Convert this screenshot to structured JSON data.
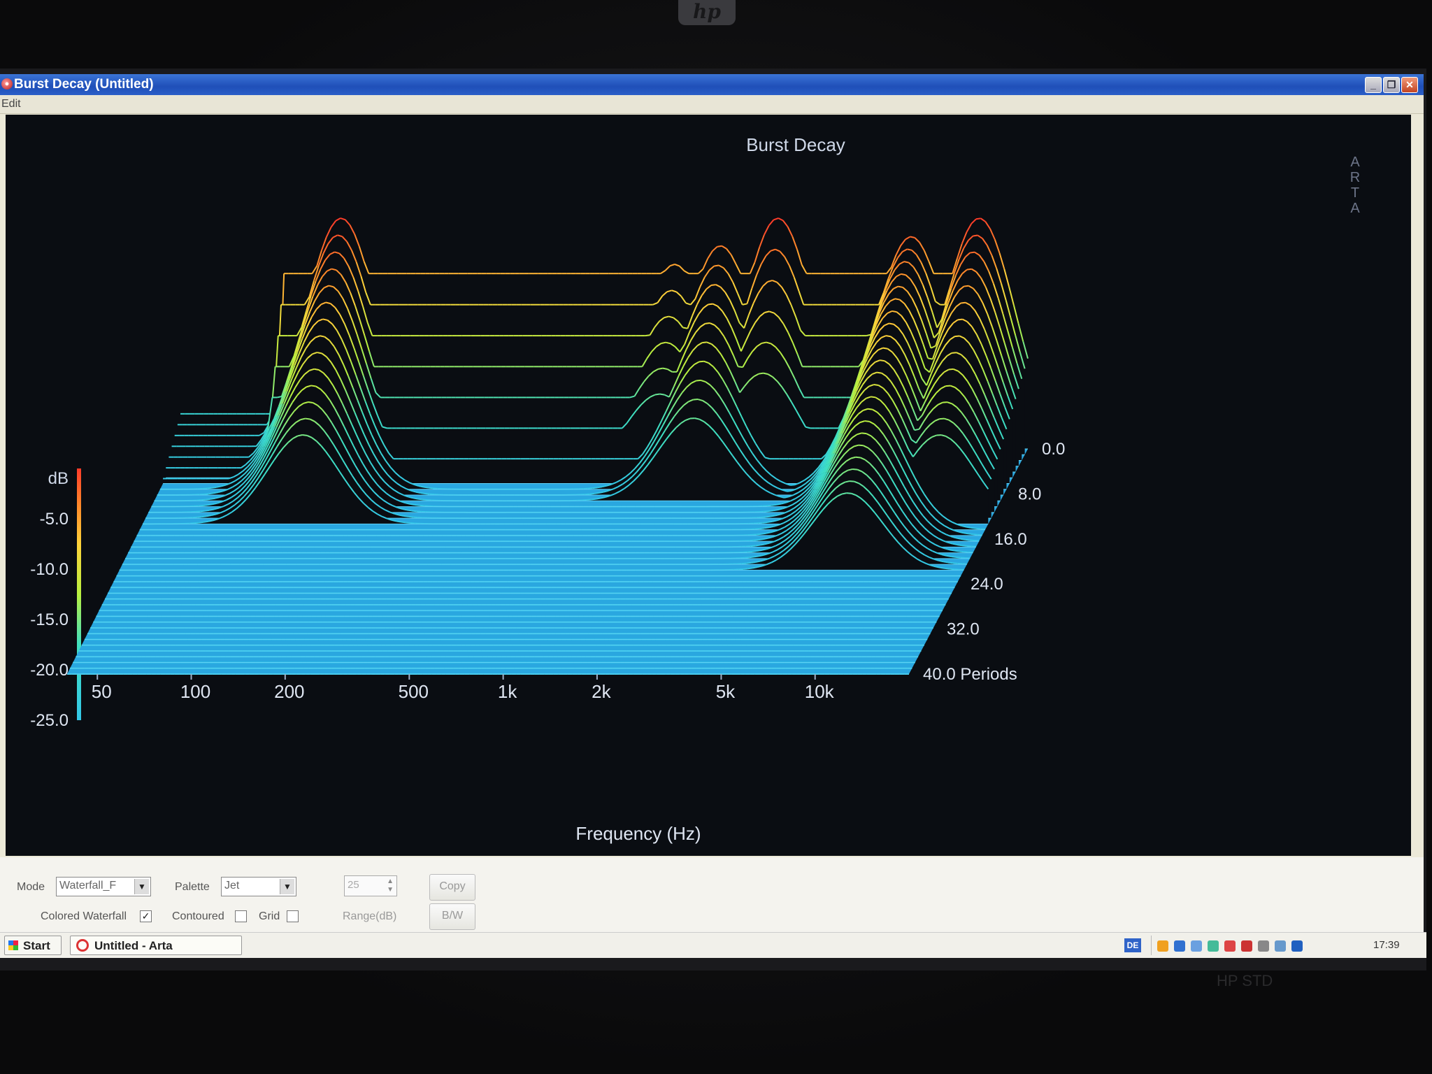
{
  "window": {
    "title": "Burst Decay  (Untitled)",
    "menu": [
      "Edit"
    ]
  },
  "chart": {
    "title": "Burst Decay",
    "watermark": "A\nR\nT\nA",
    "z_unit": "dB",
    "x_label": "Frequency (Hz)"
  },
  "chart_data": {
    "type": "area",
    "title": "Burst Decay",
    "xlabel": "Frequency (Hz)",
    "ylabel": "dB",
    "zlabel": "Periods",
    "x_scale": "log",
    "x_ticks": [
      "50",
      "100",
      "200",
      "500",
      "1k",
      "2k",
      "5k",
      "10k"
    ],
    "x_tick_values": [
      50,
      100,
      200,
      500,
      1000,
      2000,
      5000,
      10000
    ],
    "y_ticks": [
      "-5.0",
      "-10.0",
      "-15.0",
      "-20.0",
      "-25.0"
    ],
    "y_range": [
      -25,
      0
    ],
    "depth_ticks": [
      "0.0",
      "8.0",
      "16.0",
      "24.0",
      "32.0",
      "40.0 Periods"
    ],
    "depth_range": [
      0,
      40
    ],
    "palette": "Jet",
    "mode": "Waterfall",
    "peaks": [
      {
        "freq": 130,
        "level_db": 0,
        "decay_periods": 14
      },
      {
        "freq": 240,
        "level_db": -6,
        "decay_periods": 4
      },
      {
        "freq": 450,
        "level_db": -7,
        "decay_periods": 2
      },
      {
        "freq": 1500,
        "level_db": -5,
        "decay_periods": 6
      },
      {
        "freq": 2100,
        "level_db": -3,
        "decay_periods": 10
      },
      {
        "freq": 3200,
        "level_db": 0,
        "decay_periods": 6
      },
      {
        "freq": 8500,
        "level_db": -2,
        "decay_periods": 22
      },
      {
        "freq": 14000,
        "level_db": 0,
        "decay_periods": 14
      }
    ],
    "slice_count": 40
  },
  "controls": {
    "mode_label": "Mode",
    "mode_value": "Waterfall_F",
    "palette_label": "Palette",
    "palette_value": "Jet",
    "range_value": "25",
    "range_label": "Range(dB)",
    "copy_label": "Copy",
    "bw_label": "B/W",
    "colored_waterfall_label": "Colored Waterfall",
    "contoured_label": "Contoured",
    "grid_label": "Grid",
    "colored_waterfall_checked": "✓"
  },
  "taskbar": {
    "start_label": "Start",
    "task_label": "Untitled - Arta",
    "lang": "DE",
    "clock": "17:39"
  },
  "device": {
    "logo": "hp",
    "bottom_label": "HP STD"
  },
  "colors": {
    "titlebar": "#245edb",
    "plot_bg": "#0a0d12",
    "floor": "#33b5ea"
  }
}
